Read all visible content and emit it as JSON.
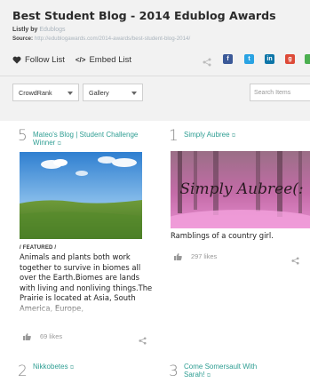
{
  "page": {
    "title": "Best Student Blog - 2014 Edublog Awards",
    "listby_prefix": "Listly by",
    "listby_author": "Edublogs",
    "source_prefix": "Source:",
    "source_url": "http://edublogawards.com/2014-awards/best-student-blog-2014/"
  },
  "actions": {
    "follow_label": "Follow List",
    "embed_label": "Embed List"
  },
  "share_colors": {
    "facebook": "#3b5998",
    "twitter": "#2aa3e3",
    "linkedin": "#0e76a8",
    "google": "#dd4b39",
    "other": "#4caf50"
  },
  "controls": {
    "sort_value": "CrowdRank",
    "view_value": "Gallery",
    "search_placeholder": "Search Items"
  },
  "items": [
    {
      "rank": "5",
      "title": "Mateo's Blog | Student Challenge Winner",
      "featured": "/ FEATURED /",
      "description": "Animals and plants both work together to survive in biomes all over the Earth.Biomes are lands with living and nonliving things.The Prairie is located at Asia, South America, Europe,",
      "likes": "69 likes",
      "image": "prairie landscape photo"
    },
    {
      "rank": "1",
      "title": "Simply Aubree",
      "image_text": "Simply Aubree(:",
      "description": "Ramblings of a country girl.",
      "likes": "297 likes"
    },
    {
      "rank": "2",
      "title": "Nikkobetes"
    },
    {
      "rank": "3",
      "title": "Come Somersault With Sarah!"
    }
  ]
}
